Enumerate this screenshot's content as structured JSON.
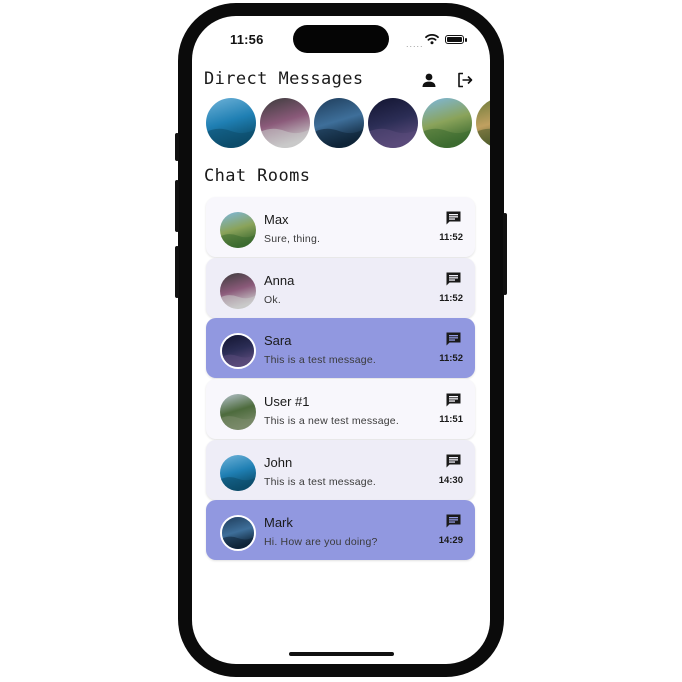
{
  "status": {
    "time": "11:56",
    "signal": "....."
  },
  "header": {
    "title": "Direct Messages"
  },
  "direct_messages": [
    {
      "name": "dm-avatar-1",
      "colors": [
        "#6fb3d9",
        "#1f7fb3",
        "#0c4d6b"
      ]
    },
    {
      "name": "dm-avatar-2",
      "colors": [
        "#3b3b3b",
        "#8b5a7a",
        "#c9c9c9"
      ]
    },
    {
      "name": "dm-avatar-3",
      "colors": [
        "#1e3c5a",
        "#3e6f9a",
        "#0f2438"
      ]
    },
    {
      "name": "dm-avatar-4",
      "colors": [
        "#121430",
        "#2b2d55",
        "#5a4a7a"
      ]
    },
    {
      "name": "dm-avatar-5",
      "colors": [
        "#7db8e0",
        "#8aa35a",
        "#3d6b30"
      ]
    },
    {
      "name": "dm-avatar-6",
      "colors": [
        "#6a7a3a",
        "#c0a060",
        "#4a5a2a"
      ]
    }
  ],
  "rooms_title": "Chat Rooms",
  "rooms": [
    {
      "name": "Max",
      "message": "Sure, thing.",
      "time": "11:52",
      "bg": "#f8f7fc",
      "ring": false,
      "colors": [
        "#7db8e0",
        "#8aa35a",
        "#3d6b30"
      ]
    },
    {
      "name": "Anna",
      "message": "Ok.",
      "time": "11:52",
      "bg": "#eeedf7",
      "ring": false,
      "colors": [
        "#3b3b3b",
        "#8b5a7a",
        "#c9c9c9"
      ]
    },
    {
      "name": "Sara",
      "message": "This is a test message.",
      "time": "11:52",
      "bg": "#9198e0",
      "ring": true,
      "colors": [
        "#121430",
        "#2b2d55",
        "#5a4a7a"
      ]
    },
    {
      "name": "User #1",
      "message": "This is a new test message.",
      "time": "11:51",
      "bg": "#f8f7fc",
      "ring": false,
      "colors": [
        "#b7c4cf",
        "#4d6b3d",
        "#7a8a6a"
      ]
    },
    {
      "name": "John",
      "message": "This is a test message.",
      "time": "14:30",
      "bg": "#eeedf7",
      "ring": false,
      "colors": [
        "#6fb3d9",
        "#1f7fb3",
        "#0c4d6b"
      ]
    },
    {
      "name": "Mark",
      "message": "Hi. How are you doing?",
      "time": "14:29",
      "bg": "#9198e0",
      "ring": true,
      "colors": [
        "#1e3c5a",
        "#3e6f9a",
        "#0f2438"
      ]
    }
  ]
}
